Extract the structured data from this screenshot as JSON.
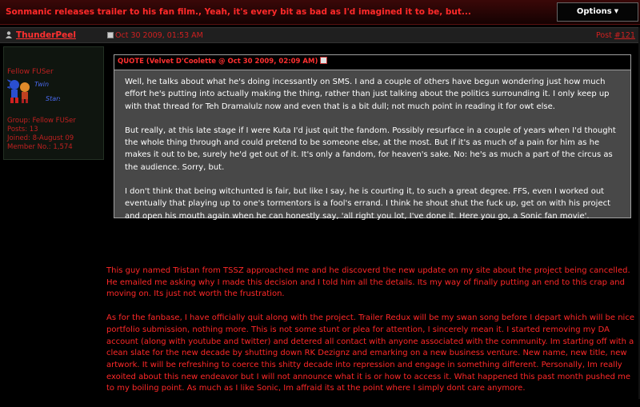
{
  "topic": {
    "title": "Sonmanic releases trailer to his fan film., Yeah, it's every bit as bad as I'd imagined it to be, but...",
    "options_label": "Options"
  },
  "post": {
    "username": "ThunderPeel",
    "date": "Oct 30 2009, 01:53 AM",
    "post_label": "Post ",
    "post_number": "#121"
  },
  "author": {
    "title": "Fellow FUSer",
    "avatar_text_1": "Twin",
    "avatar_text_2": "Stars",
    "group": "Group: Fellow FUSer",
    "posts": "Posts: 13",
    "joined": "Joined: 8-August 09",
    "member_no": "Member No.: 1,574"
  },
  "quote": {
    "header": "QUOTE (Velvet D'Coolette @ Oct 30 2009, 02:09 AM)",
    "paragraphs": [
      "Well, he talks about what he's doing incessantly on SMS. I and a couple of others have begun wondering just how much effort he's putting into actually making the thing, rather than just talking about the politics surrounding it. I only keep up with that thread for Teh Dramalulz now and even that is a bit dull; not much point in reading it for owt else.",
      "But really, at this late stage if I were Kuta I'd just quit the fandom. Possibly resurface in a couple of years when I'd thought the whole thing through and could pretend to be someone else, at the most. But if it's as much of a pain for him as he makes it out to be, surely he'd get out of it. It's only a fandom, for heaven's sake. No: he's as much a part of the circus as the audience. Sorry, but.",
      "I don't think that being witchunted is fair, but like I say, he is courting it, to such a great degree. FFS, even I worked out eventually that playing up to one's tormentors is a fool's errand. I think he shout shut the fuck up, get on with his project and open his mouth again when he can honestly say, 'all right you lot, I've done it. Here you go, a Sonic fan movie'."
    ]
  },
  "reply": {
    "paragraphs": [
      "This guy named Tristan from TSSZ approached me and he discoverd the new update on my site about the project being cancelled. He emailed me asking why I made this decision and I told him all the details. Its my way of finally putting an end to this crap and moving on. Its just not worth the frustration.",
      "As for the fanbase, I have officially quit along with the project. Trailer Redux will be my swan song before I depart which will be nice portfolio submission, nothing more. This is not some stunt or plea for attention, I sincerely mean it. I started removing my DA account (along with youtube and twitter) and detered all contact with anyone associated with the community. Im starting off with a clean slate for the new decade by shutting down RK Dezignz and emarking on a new business venture. New name, new title, new artwork. It will be refreshing to coerce this shitty decade into repression and engage in something different. Personally, Im really exoited about this new endeavor but I will not announce what it is or how to access it. What happened this past month pushed me to my boiling point. As much as I like Sonic, Im affraid its at the point where I simply dont care anymore."
    ]
  }
}
